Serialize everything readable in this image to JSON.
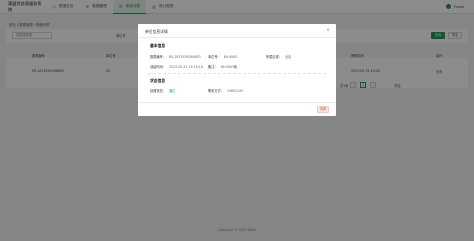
{
  "app": {
    "title": "莆盟贷务我服务系统"
  },
  "nav": {
    "items": [
      {
        "label": "数据总览",
        "icon": "dashboard-icon"
      },
      {
        "label": "数据管理",
        "icon": "database-icon"
      },
      {
        "label": "审核流程",
        "icon": "audit-icon"
      },
      {
        "label": "统计报表",
        "icon": "report-icon"
      }
    ]
  },
  "user": {
    "name": "Frank"
  },
  "breadcrumb": "首页 / 数据管理 / 明细列表",
  "filters": {
    "input1_placeholder": "请选择数据",
    "label2": "单位号",
    "search_label": "查询",
    "extra_label": "导出"
  },
  "table": {
    "headers": [
      "报表编号",
      "单位号",
      "审核时间",
      "操作"
    ],
    "row": [
      "RS-1675539286853",
      "43",
      "2023-05-31 19:00",
      "查看"
    ]
  },
  "pager": {
    "text": "共1条",
    "page": "1",
    "goto": "前往"
  },
  "footer": "Copyright © 2023 Bank",
  "modal": {
    "title": "单位信息详情",
    "close_icon": "×",
    "section1": {
      "title": "基本信息",
      "fields": [
        {
          "label": "报表编号：",
          "value": "RS-1675539286853"
        },
        {
          "label": "单位号：",
          "value": "89-9063"
        },
        {
          "label": "所属区域：",
          "value": "北京"
        },
        {
          "label": "创建时间：",
          "value": "2023-05-31 19:16:18"
        },
        {
          "label": "备注：",
          "value": "89-9063备"
        }
      ]
    },
    "section2": {
      "title": "状态信息",
      "fields": [
        {
          "label": "处理状态：",
          "value": "通过"
        },
        {
          "label": "联系方式：",
          "value": "15691245"
        }
      ]
    },
    "close_button": "关闭"
  }
}
